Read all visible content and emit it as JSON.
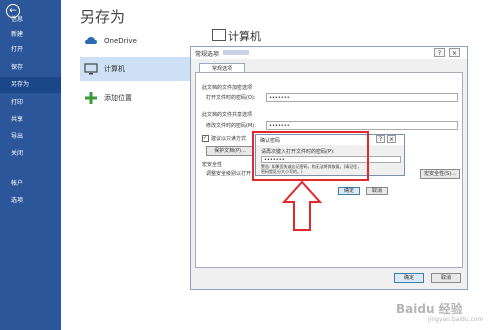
{
  "nav": {
    "items": [
      "信息",
      "新建",
      "打开",
      "保存",
      "另存为",
      "打印",
      "共享",
      "导出",
      "关闭",
      "帐户",
      "选项"
    ],
    "selected_index": 4
  },
  "backstage": {
    "title": "另存为",
    "places": [
      "OneDrive",
      "计算机",
      "添加位置"
    ],
    "selected_place_index": 1,
    "right_title": "计算机"
  },
  "dialog": {
    "title": "常规选项",
    "tab": "常规选项",
    "section_open": "此文档的文件加密选项",
    "open_pw_label": "打开文件时的密码(O):",
    "open_pw_value": "•••••••",
    "section_modify": "此文档的文件共享选项",
    "modify_pw_label": "修改文件时的密码(M):",
    "modify_pw_value": "•••••••",
    "readonly_label": "建议以只读方式",
    "protect_button": "保护文档(P)...",
    "macro_section": "宏安全性",
    "macro_text": "调整安全级别以打开",
    "macro_button": "宏安全性(S)...",
    "ok": "确定",
    "cancel": "取消"
  },
  "confirm": {
    "title": "确认密码",
    "prompt": "请再次键入打开文件时的密码(P):",
    "value": "•••••••",
    "warning_1": "警告: 如果丢失或忘记密码，则无法将其恢复。(请记住，",
    "warning_2": "密码是区分大小写的。)",
    "ok": "确定",
    "cancel": "取消"
  },
  "watermark": "Baidu 经验",
  "watermark_url": "jingyan.baidu.com",
  "colors": {
    "nav_bg": "#2b579a",
    "highlight": "#e0292b"
  }
}
